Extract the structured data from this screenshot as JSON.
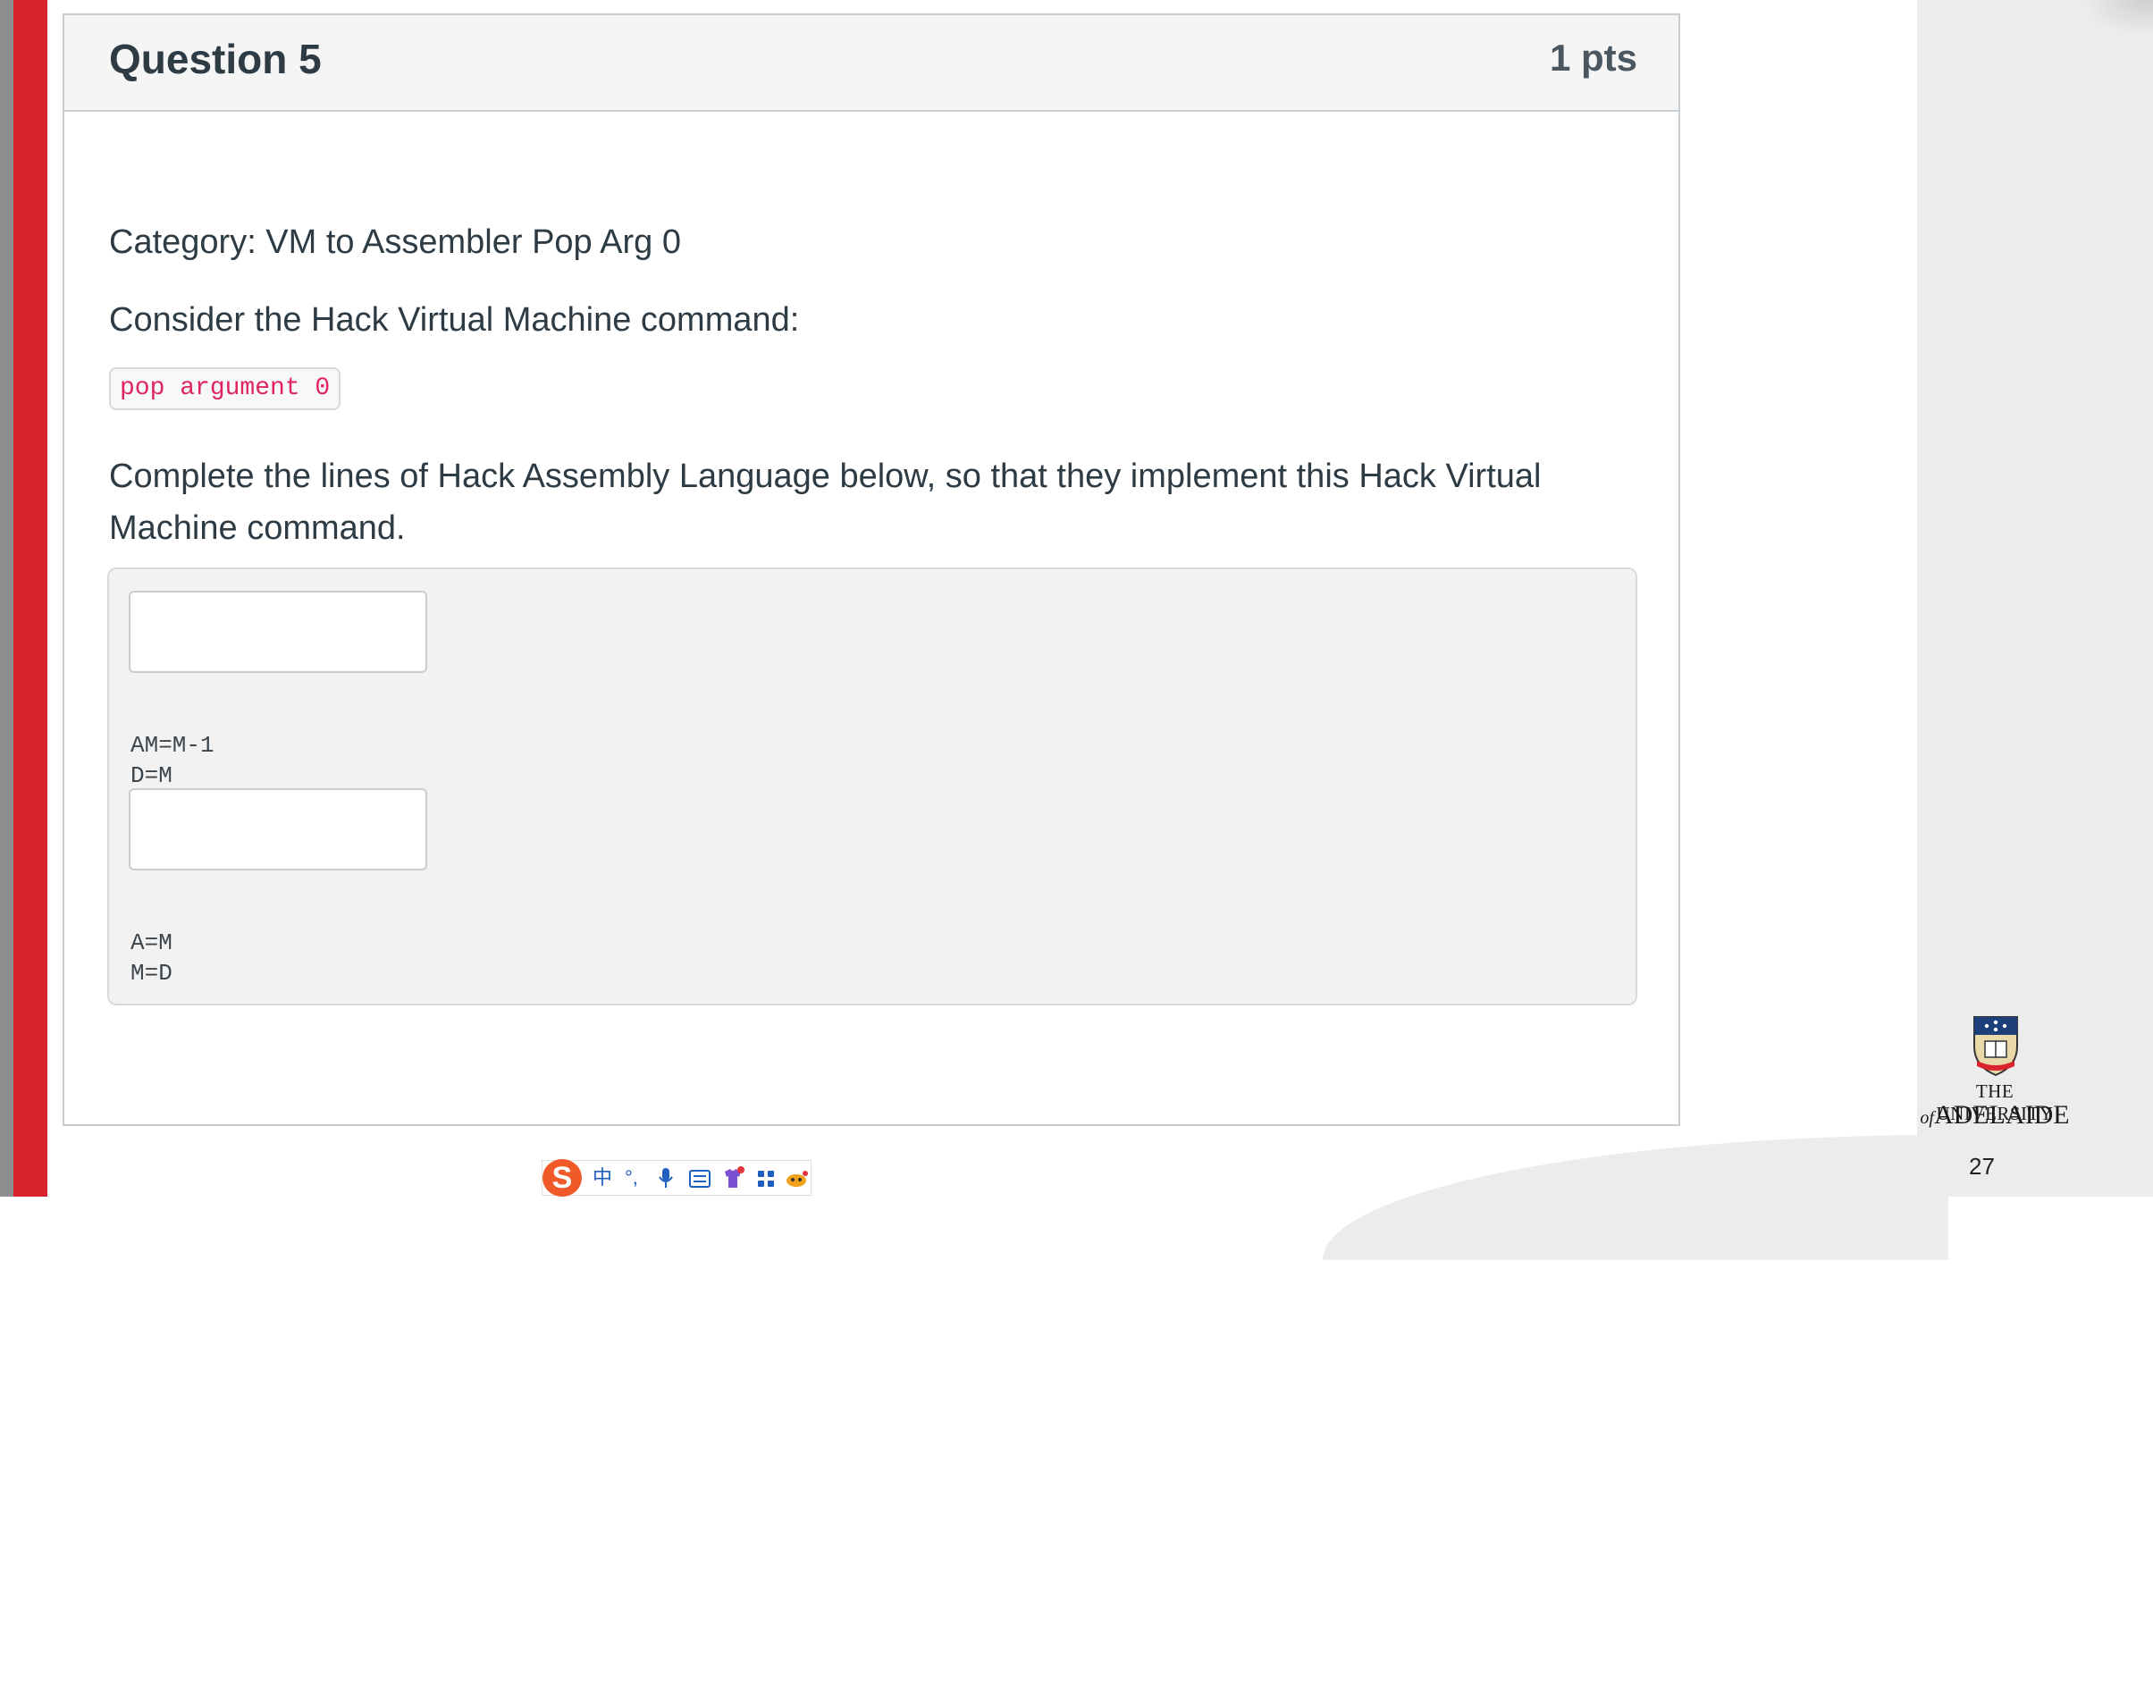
{
  "question": {
    "title": "Question 5",
    "points": "1 pts",
    "category": "Category: VM to Assembler Pop Arg 0",
    "prompt": "Consider the Hack Virtual Machine command:",
    "command": "pop argument 0",
    "instruction_line1": "Complete the lines of Hack Assembly Language below, so that they implement this Hack Virtual",
    "instruction_line2": "Machine command."
  },
  "answer_area": {
    "blank1_value": "",
    "code_block_1": [
      "AM=M-1",
      "D=M"
    ],
    "blank2_value": "",
    "code_block_2": [
      "A=M",
      "M=D"
    ]
  },
  "branding": {
    "line1": "THE UNIVERSITY",
    "line2_prefix": "of",
    "line2": "ADELAIDE",
    "page_number": "27"
  },
  "ime_toolbar": {
    "logo": "S",
    "items": [
      "中",
      "°,",
      "mic-icon",
      "keyboard-icon",
      "shirt-icon",
      "apps-icon",
      "emoji-icon"
    ]
  },
  "colors": {
    "accent_red": "#d9232e",
    "code_red": "#e0245e",
    "text_dark": "#2d3b45"
  }
}
